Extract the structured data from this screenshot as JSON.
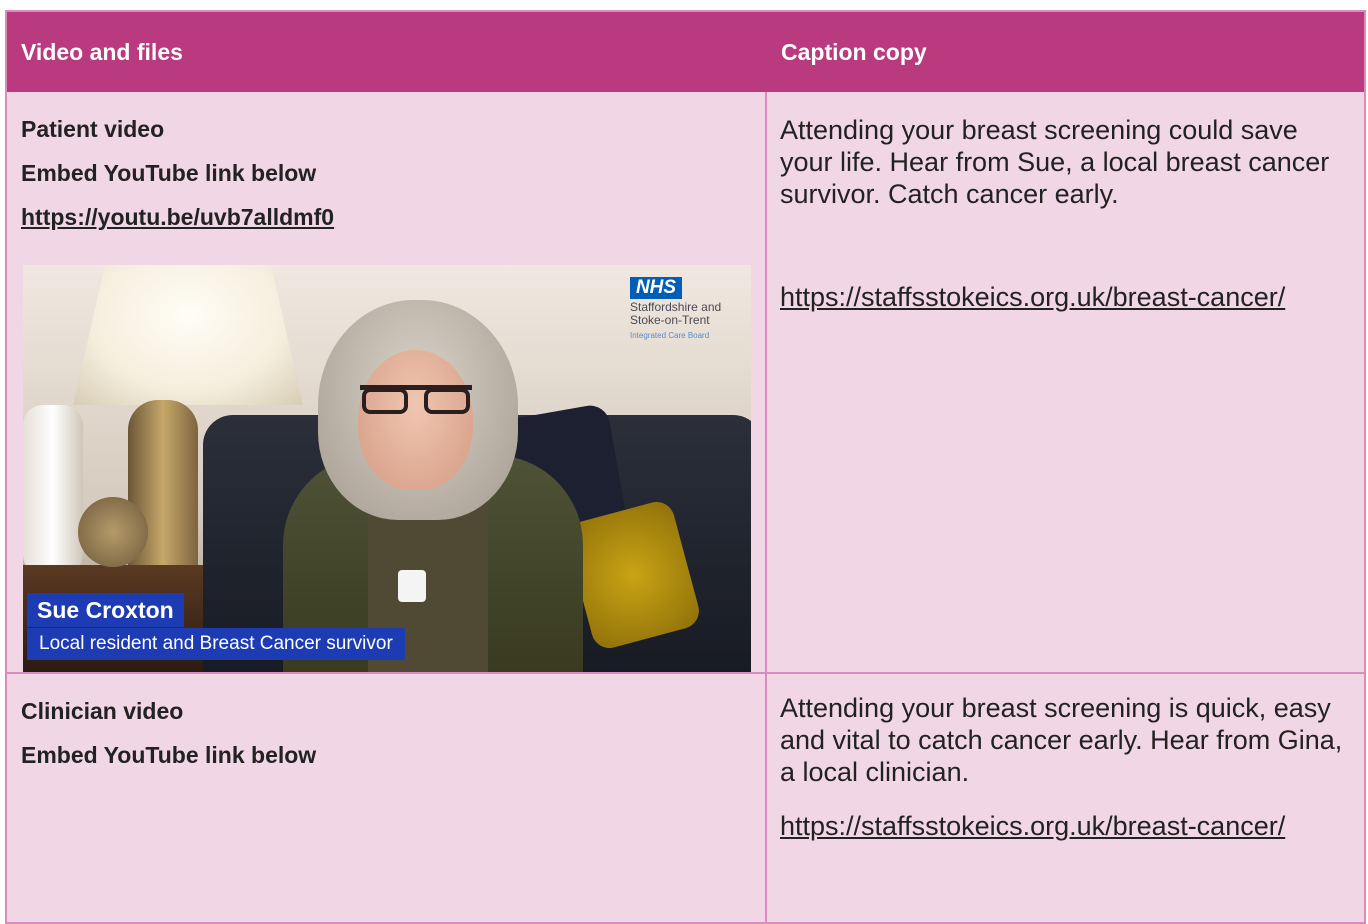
{
  "header": {
    "col1": "Video and files",
    "col2": "Caption copy"
  },
  "row1": {
    "title": "Patient video",
    "instruction": "Embed YouTube link below",
    "link": "https://youtu.be/uvb7alldmf0",
    "caption": "Attending your breast screening could save your life. Hear from Sue, a local breast cancer survivor. Catch cancer early.",
    "caption_link": "https://staffsstokeics.org.uk/breast-cancer/",
    "video": {
      "nhs_logo": "NHS",
      "nhs_org": "Staffordshire and Stoke-on-Trent",
      "nhs_sub": "Integrated Care Board",
      "name": "Sue Croxton",
      "description": "Local resident and Breast Cancer survivor"
    }
  },
  "row2": {
    "title": "Clinician video",
    "instruction": "Embed YouTube link below",
    "caption": "Attending your breast screening is quick, easy and vital to catch cancer early. Hear from Gina, a local clinician.",
    "caption_link": "https://staffsstokeics.org.uk/breast-cancer/"
  },
  "colors": {
    "header_bg": "#ba3a80",
    "row_bg": "#f1d6e6",
    "border": "#d98cbd",
    "lower_third": "#1d3bb3",
    "nhs_blue": "#005eb8"
  }
}
